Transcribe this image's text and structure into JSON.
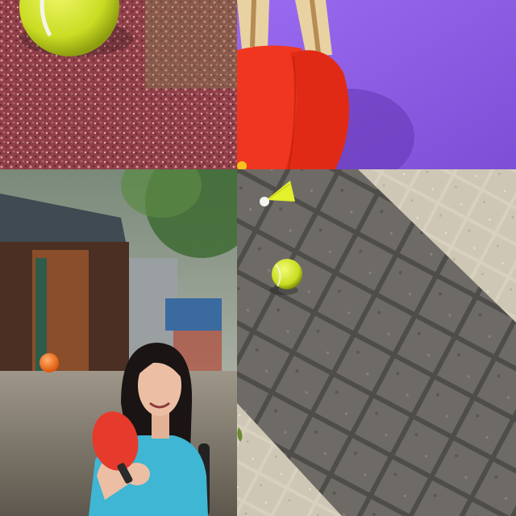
{
  "collage": {
    "tiles": [
      {
        "id": "tennis-ball-on-gravel",
        "subject": "tennis-ball",
        "surface": "red-gravel"
      },
      {
        "id": "ping-pong-paddles",
        "subject": "table-tennis-paddles",
        "background": "purple"
      },
      {
        "id": "woman-with-paddle",
        "subject": "woman-holding-red-paddle",
        "setting": "outdoor-street"
      },
      {
        "id": "ball-and-shuttlecock-on-tiles",
        "subject": "tennis-ball-and-shuttlecock",
        "surface": "stone-tiles"
      }
    ]
  },
  "colors": {
    "tennis_ball": "#d6e62a",
    "gravel": "#9c4a4f",
    "purple_bg": "#8f5fe0",
    "paddle_red": "#e8321e",
    "paddle_handle": "#e9d2a2",
    "shirt": "#3fb6d3",
    "hair": "#1a1414",
    "tile_light": "#cfc7b5",
    "tile_dark": "#6e6b66"
  }
}
